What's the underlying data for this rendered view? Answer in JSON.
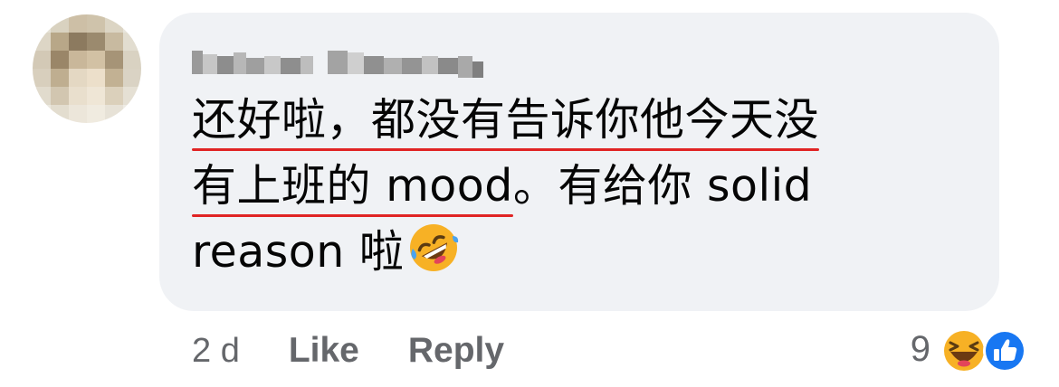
{
  "comment": {
    "author": "",
    "text_lines": {
      "line1_underlined": "还好啦，都没有告诉你他今天没",
      "line2_underlined": "有上班的 mood",
      "line2_rest": "。有给你 solid",
      "line3": "reason 啦"
    },
    "emoji": "rofl-emoji"
  },
  "actions": {
    "timestamp": "2 d",
    "like_label": "Like",
    "reply_label": "Reply"
  },
  "reactions": {
    "count": "9",
    "icons": [
      "haha-icon",
      "like-icon"
    ]
  },
  "colors": {
    "bubble": "#f0f2f5",
    "text": "#050505",
    "meta": "#65676b",
    "underline": "#e02424",
    "like_blue": "#1877f2",
    "emoji_yellow": "#f7b125"
  }
}
